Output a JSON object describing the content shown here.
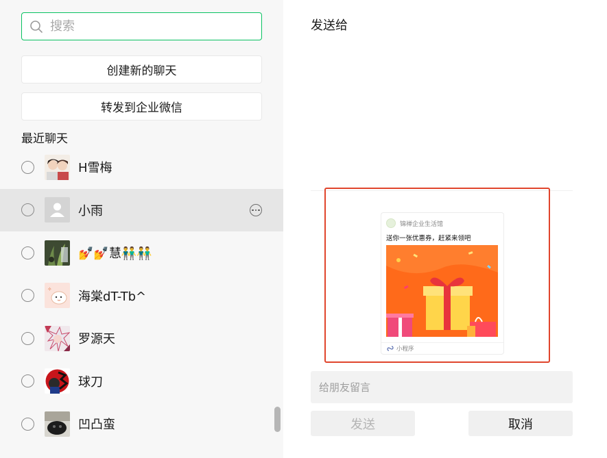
{
  "search": {
    "placeholder": "搜索"
  },
  "actions": {
    "create_chat": "创建新的聊天",
    "forward_wecom": "转发到企业微信"
  },
  "recent_label": "最近聊天",
  "contacts": [
    {
      "name": "H雪梅",
      "selected": false,
      "avatar_icon": "couple-photo-avatar"
    },
    {
      "name": "小雨",
      "selected": false,
      "avatar_icon": "default-user-avatar",
      "hovered": true
    },
    {
      "name": "💅💅慧👬👬",
      "selected": false,
      "avatar_icon": "plant-photo-avatar"
    },
    {
      "name": "海棠dT-Tb^",
      "selected": false,
      "avatar_icon": "cartoon-cat-avatar"
    },
    {
      "name": "罗源天",
      "selected": false,
      "avatar_icon": "anime-avatar"
    },
    {
      "name": "球刀",
      "selected": false,
      "avatar_icon": "calligraphy-avatar"
    },
    {
      "name": "凹凸蛮",
      "selected": false,
      "avatar_icon": "dark-photo-avatar"
    }
  ],
  "send_panel": {
    "title": "发送给",
    "share_card": {
      "source": "锦禅企业生活馆",
      "text": "送你一张优惠券，赶紧来领吧",
      "footer": "小程序"
    },
    "message_placeholder": "给朋友留言",
    "send_label": "发送",
    "cancel_label": "取消"
  },
  "colors": {
    "accent_green": "#07c160",
    "highlight_red": "#e0442b",
    "promo_orange": "#ff6a1a"
  }
}
